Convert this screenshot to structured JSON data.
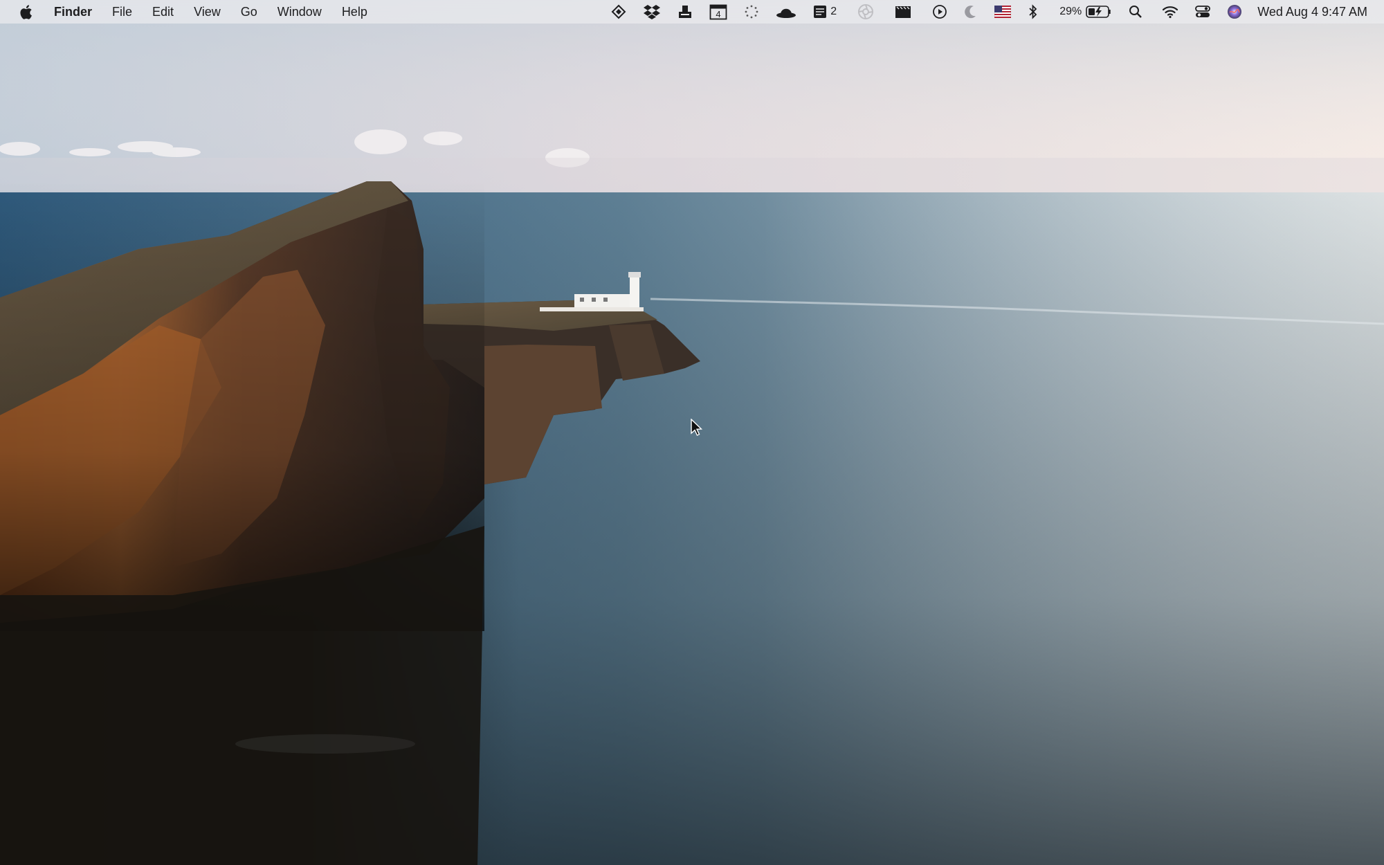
{
  "menubar": {
    "apple_icon": "apple-logo-icon",
    "app_name": "Finder",
    "menus": [
      "File",
      "Edit",
      "View",
      "Go",
      "Window",
      "Help"
    ],
    "status_icons": [
      "arrange-icon",
      "dropbox-icon",
      "printer-icon",
      "calendar-icon",
      "loading-dots-icon",
      "hat-icon",
      "notes-badge-icon",
      "aperture-icon",
      "clapperboard-icon",
      "play-icon",
      "moon-icon",
      "us-flag-icon",
      "bluetooth-icon",
      "battery-icon",
      "search-icon",
      "wifi-icon",
      "control-center-icon",
      "siri-icon"
    ],
    "calendar_day": "4",
    "notes_count": "2",
    "battery_percent": "29%",
    "clock": "Wed Aug 4  9:47 AM"
  },
  "desktop": {
    "wallpaper": "coastal cliffs with lighthouse at sunrise",
    "cursor_icon": "arrow-cursor-icon"
  },
  "colors": {
    "menubar_bg": "#ececee",
    "menubar_text": "#1d1d1f"
  }
}
